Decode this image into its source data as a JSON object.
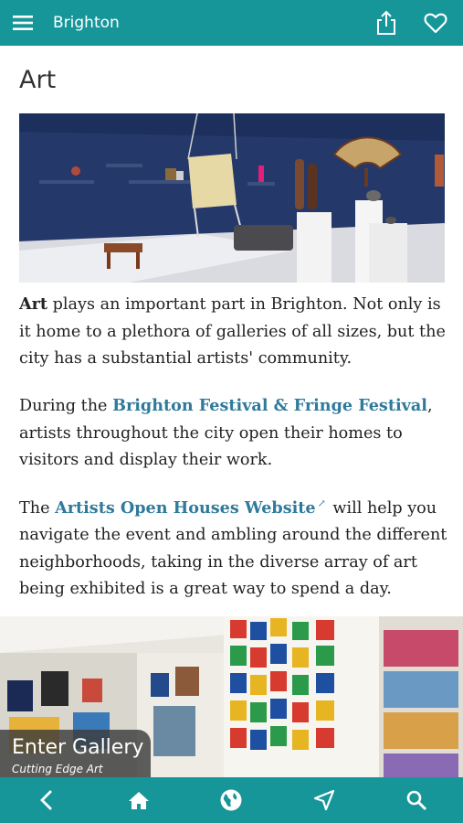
{
  "header": {
    "title": "Brighton",
    "icons": [
      "menu-icon",
      "share-icon",
      "heart-icon"
    ]
  },
  "article": {
    "title": "Art",
    "p1": {
      "bold": "Art",
      "rest": " plays an important part in Brighton. Not only is it home to a plethora of galleries of all sizes, but the city has a substantial artists' community."
    },
    "p2": {
      "before": "During the ",
      "link": "Brighton Festival & Fringe Festival",
      "after": ", artists throughout the city open their homes to visitors and display their work."
    },
    "p3": {
      "before": "The ",
      "link": "Artists Open Houses Website",
      "ext_icon": "external-link-icon",
      "after": " will help you navigate the event and ambling around the different neighborhoods, taking in the diverse array of art being exhibited is a great way to spend a day."
    }
  },
  "gallery": {
    "title": "Enter Gallery",
    "subtitle": "Cutting Edge Art"
  },
  "bottom_nav": {
    "icons": [
      "back-icon",
      "home-icon",
      "globe-icon",
      "navigate-icon",
      "search-icon"
    ]
  },
  "colors": {
    "bar": "#17969a",
    "link": "#2f7a9b",
    "text": "#222222"
  }
}
